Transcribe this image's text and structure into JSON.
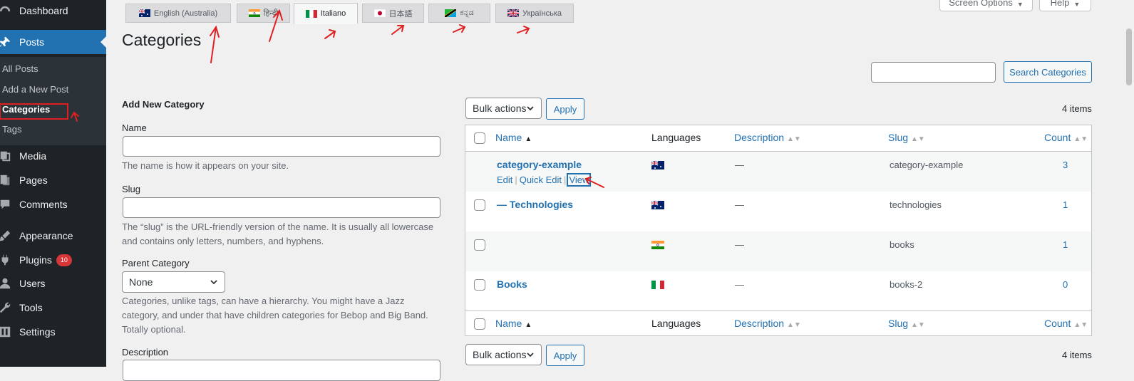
{
  "sidebar": {
    "items": [
      {
        "label": "Dashboard",
        "icon": "dashboard-icon"
      },
      {
        "label": "Posts",
        "icon": "pushpin-icon"
      },
      {
        "label": "Media",
        "icon": "media-icon"
      },
      {
        "label": "Pages",
        "icon": "pages-icon"
      },
      {
        "label": "Comments",
        "icon": "comments-icon"
      },
      {
        "label": "Appearance",
        "icon": "paintbrush-icon"
      },
      {
        "label": "Plugins",
        "icon": "plug-icon",
        "badge": "10"
      },
      {
        "label": "Users",
        "icon": "user-icon"
      },
      {
        "label": "Tools",
        "icon": "wrench-icon"
      },
      {
        "label": "Settings",
        "icon": "settings-icon"
      }
    ],
    "submenu": [
      "All Posts",
      "Add a New Post",
      "Categories",
      "Tags"
    ]
  },
  "top_buttons": {
    "screen_options": "Screen Options",
    "help": "Help"
  },
  "lang_tabs": [
    {
      "label": "English (Australia)",
      "flag": "au"
    },
    {
      "label": "हिन्दी",
      "flag": "in"
    },
    {
      "label": "Italiano",
      "flag": "it",
      "active": true
    },
    {
      "label": "日本語",
      "flag": "jp"
    },
    {
      "label": "ಕನ್ನಡ",
      "flag": "tz"
    },
    {
      "label": "Українська",
      "flag": "gb"
    }
  ],
  "page_title": "Categories",
  "search": {
    "button": "Search Categories",
    "value": ""
  },
  "form": {
    "heading": "Add New Category",
    "name_label": "Name",
    "name_help": "The name is how it appears on your site.",
    "slug_label": "Slug",
    "slug_help": "The “slug” is the URL-friendly version of the name. It is usually all lowercase and contains only letters, numbers, and hyphens.",
    "parent_label": "Parent Category",
    "parent_value": "None",
    "parent_help": "Categories, unlike tags, can have a hierarchy. You might have a Jazz category, and under that have children categories for Bebop and Big Band. Totally optional.",
    "description_label": "Description"
  },
  "table": {
    "bulk_actions": "Bulk actions",
    "apply": "Apply",
    "items_count": "4 items",
    "columns": {
      "name": "Name",
      "languages": "Languages",
      "description": "Description",
      "slug": "Slug",
      "count": "Count"
    },
    "row_actions": {
      "edit": "Edit",
      "quick_edit": "Quick Edit",
      "view": "View"
    },
    "rows": [
      {
        "name": "category-example",
        "flag": "au",
        "description": "—",
        "slug": "category-example",
        "count": "3"
      },
      {
        "name": "— Technologies",
        "flag": "au",
        "description": "—",
        "slug": "technologies",
        "count": "1"
      },
      {
        "name": "",
        "flag": "in",
        "description": "—",
        "slug": "books",
        "count": "1"
      },
      {
        "name": "Books",
        "flag": "it",
        "description": "—",
        "slug": "books-2",
        "count": "0"
      }
    ]
  },
  "colors": {
    "sidebar_bg": "#1d2327",
    "accent": "#2271b1",
    "annotation": "#e02020",
    "badge": "#d63638"
  }
}
